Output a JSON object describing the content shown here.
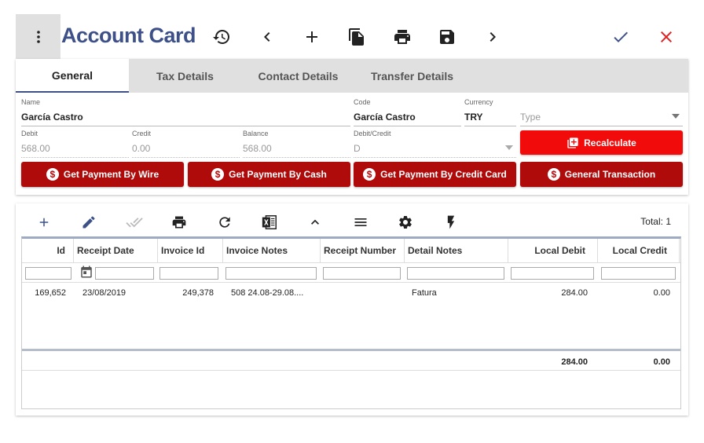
{
  "header": {
    "title": "Account Card"
  },
  "tabs": [
    {
      "label": "General"
    },
    {
      "label": "Tax Details"
    },
    {
      "label": "Contact Details"
    },
    {
      "label": "Transfer Details"
    }
  ],
  "form": {
    "name_label": "Name",
    "name_value": "García Castro",
    "code_label": "Code",
    "code_value": "García Castro",
    "currency_label": "Currency",
    "currency_value": "TRY",
    "type_placeholder": "Type",
    "debit_label": "Debit",
    "debit_value": "568.00",
    "credit_label": "Credit",
    "credit_value": "0.00",
    "balance_label": "Balance",
    "balance_value": "568.00",
    "debitcredit_label": "Debit/Credit",
    "debitcredit_value": "D",
    "recalculate_label": "Recalculate"
  },
  "actions": {
    "wire": "Get Payment By Wire",
    "cash": "Get Payment By Cash",
    "credit_card": "Get Payment By Credit Card",
    "general": "General Transaction"
  },
  "grid": {
    "total_label": "Total: 1",
    "columns": [
      "Id",
      "Receipt Date",
      "Invoice Id",
      "Invoice Notes",
      "Receipt Number",
      "Detail Notes",
      "Local Debit",
      "Local Credit"
    ],
    "rows": [
      {
        "id": "169,652",
        "receipt_date": "23/08/2019",
        "invoice_id": "249,378",
        "invoice_notes": "508 24.08-29.08....",
        "receipt_number": "",
        "detail_notes": "Fatura",
        "local_debit": "284.00",
        "local_credit": "0.00"
      }
    ],
    "totals": {
      "local_debit": "284.00",
      "local_credit": "0.00"
    }
  },
  "colors": {
    "accent": "#3d5188",
    "action_red": "#b00b0b",
    "recalc_red": "#f20b0b",
    "confirm": "#3d5188",
    "cancel": "#e02020"
  }
}
